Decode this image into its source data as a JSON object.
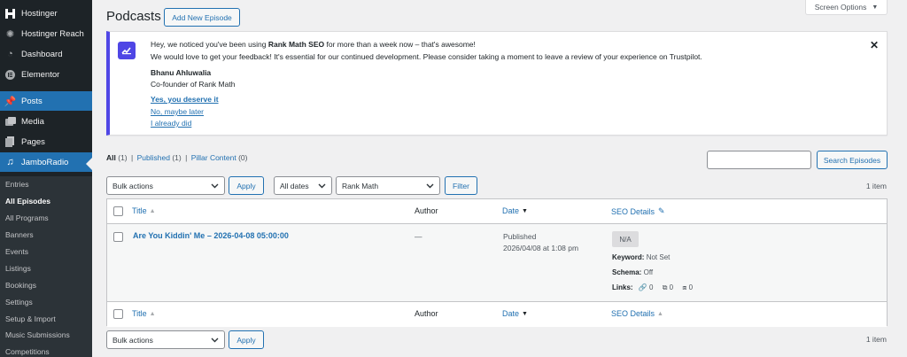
{
  "sidebar": {
    "items": [
      {
        "label": "Hostinger",
        "icon": "hostinger-icon"
      },
      {
        "label": "Hostinger Reach",
        "icon": "reach-icon"
      },
      {
        "label": "Dashboard",
        "icon": "dashboard-icon"
      },
      {
        "label": "Elementor",
        "icon": "elementor-icon"
      },
      {
        "label": "Posts",
        "icon": "pin-icon"
      },
      {
        "label": "Media",
        "icon": "media-icon"
      },
      {
        "label": "Pages",
        "icon": "pages-icon"
      },
      {
        "label": "JamboRadio",
        "icon": "music-icon"
      }
    ],
    "subitems": [
      "Entries",
      "All Episodes",
      "All Programs",
      "Banners",
      "Events",
      "Listings",
      "Bookings",
      "Settings",
      "Setup & Import",
      "Music Submissions",
      "Competitions"
    ]
  },
  "header": {
    "title": "Podcasts",
    "add_new": "Add New Episode",
    "screen_options": "Screen Options"
  },
  "notice": {
    "line1_pre": "Hey, we noticed you've been using ",
    "line1_bold": "Rank Math SEO",
    "line1_post": " for more than a week now – that's awesome!",
    "line2": "We would love to get your feedback! It's essential for our continued development. Please consider taking a moment to leave a review of your experience on Trustpilot.",
    "author": "Bhanu Ahluwalia",
    "role": "Co-founder of Rank Math",
    "link_yes": "Yes, you deserve it",
    "link_later": "No, maybe later",
    "link_did": "I already did"
  },
  "views": {
    "all": "All",
    "all_count": "(1)",
    "published": "Published",
    "published_count": "(1)",
    "pillar": "Pillar Content",
    "pillar_count": "(0)",
    "sep": "|"
  },
  "search": {
    "button": "Search Episodes"
  },
  "filters": {
    "bulk_actions": "Bulk actions",
    "apply": "Apply",
    "dates": "All dates",
    "seo": "Rank Math",
    "filter": "Filter",
    "items_count": "1 item"
  },
  "table": {
    "columns": {
      "title": "Title",
      "author": "Author",
      "date": "Date",
      "seo": "SEO Details"
    },
    "rows": [
      {
        "title": "Are You Kiddin' Me – 2026-04-08 05:00:00",
        "author": "—",
        "status": "Published",
        "date": "2026/04/08 at 1:08 pm",
        "seo_badge": "N/A",
        "keyword_label": "Keyword:",
        "keyword_value": "Not Set",
        "schema_label": "Schema:",
        "schema_value": "Off",
        "links_label": "Links:",
        "internal_links": "0",
        "external_links": "0",
        "incoming_links": "0"
      }
    ]
  }
}
